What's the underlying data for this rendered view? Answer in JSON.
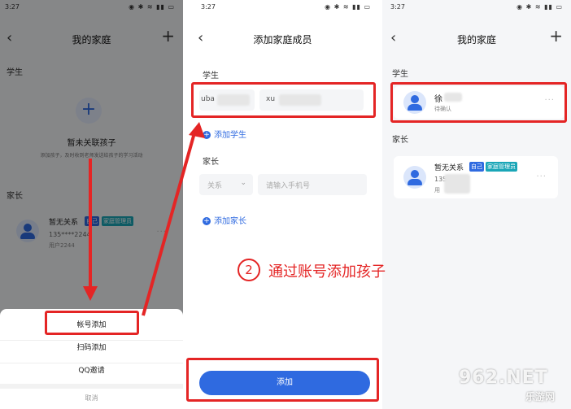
{
  "panel1": {
    "time": "3:27",
    "status_icons": "◉ ✱ ≋ ▮▮ ▭",
    "title": "我的家庭",
    "students_label": "学生",
    "empty_title": "暂未关联孩子",
    "empty_desc": "添加孩子，及时收到老师发送给孩子的学习活动",
    "parents_label": "家长",
    "parent": {
      "name": "暂无关系",
      "self_badge": "自己",
      "admin_badge": "家庭管理员",
      "phone": "135****2244",
      "user": "用户2244"
    },
    "sheet": {
      "account_add": "帐号添加",
      "scan_add": "扫码添加",
      "qq_invite": "QQ邀请",
      "cancel": "取消"
    }
  },
  "panel2": {
    "time": "3:27",
    "status_icons": "◉ ✱ ≋ ▮▮ ▭",
    "title": "添加家庭成员",
    "students_label": "学生",
    "student_name_value": "uba",
    "student_account_value": "xu",
    "add_student": "添加学生",
    "parents_label": "家长",
    "relation_placeholder": "关系",
    "phone_placeholder": "请输入手机号",
    "add_parent": "添加家长",
    "submit": "添加"
  },
  "panel3": {
    "time": "3:27",
    "status_icons": "◉ ✱ ≋ ▮▮ ▭",
    "title": "我的家庭",
    "students_label": "学生",
    "student": {
      "name": "徐",
      "status": "待确认"
    },
    "parents_label": "家长",
    "parent": {
      "name": "暂无关系",
      "self_badge": "自己",
      "admin_badge": "家庭管理员",
      "phone": "135**",
      "user": "用"
    }
  },
  "annotation": {
    "step_number": "2",
    "step_text": "通过账号添加孩子"
  },
  "watermark": {
    "brand": "962.NET",
    "sub": "乐游网"
  },
  "colors": {
    "accent": "#2f6ae0",
    "highlight_red": "#e42525",
    "self_badge": "#2f6ae0",
    "admin_badge": "#1aa6b7"
  }
}
